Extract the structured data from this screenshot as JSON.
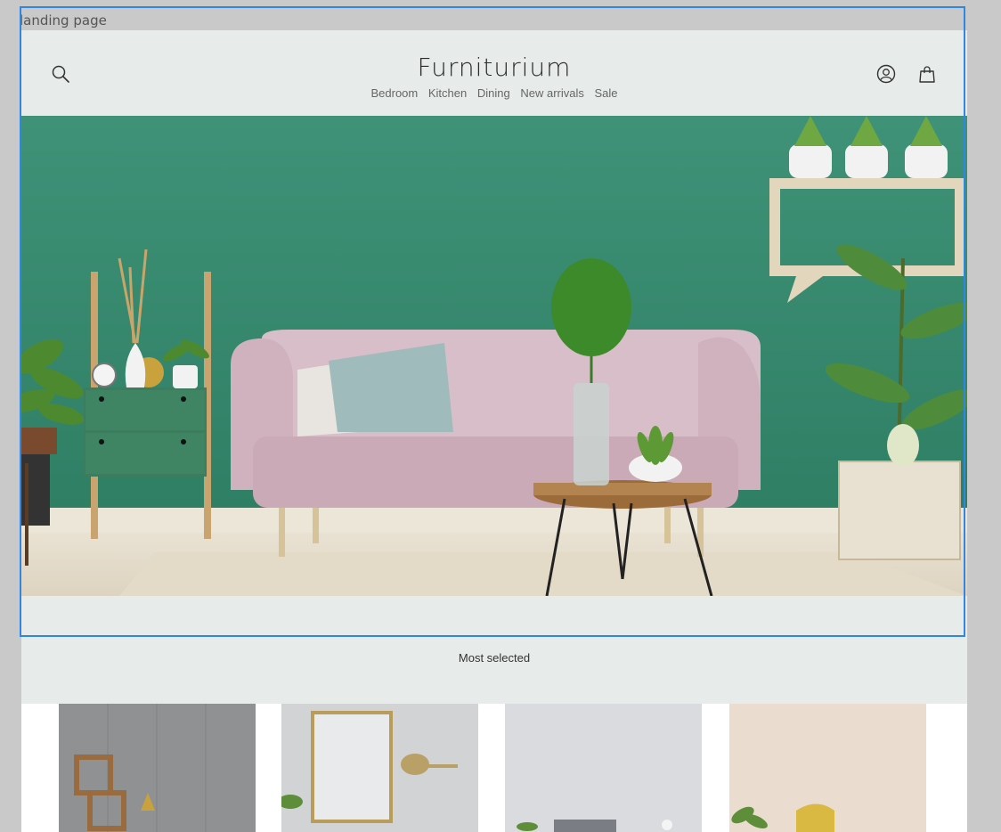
{
  "canvas": {
    "frame_label": "landing page"
  },
  "header": {
    "brand": "Furniturium",
    "nav": [
      "Bedroom",
      "Kitchen",
      "Dining",
      "New arrivals",
      "Sale"
    ]
  },
  "icons": {
    "search": "search-icon",
    "account": "user-icon",
    "cart": "shopping-bag-icon"
  },
  "hero": {
    "image": "living-room-pink-sofa-green-wall"
  },
  "most_selected": {
    "title": "Most selected",
    "products": [
      {
        "image": "geometric-shelf-gray-wall"
      },
      {
        "image": "frame-wall-lamp"
      },
      {
        "image": "gray-sofa-light-room"
      },
      {
        "image": "yellow-chair-beige-room"
      }
    ]
  },
  "colors": {
    "accent_green": "#4f9a80",
    "page_bg": "#e7ebea",
    "selection_blue": "#2f86e6"
  }
}
